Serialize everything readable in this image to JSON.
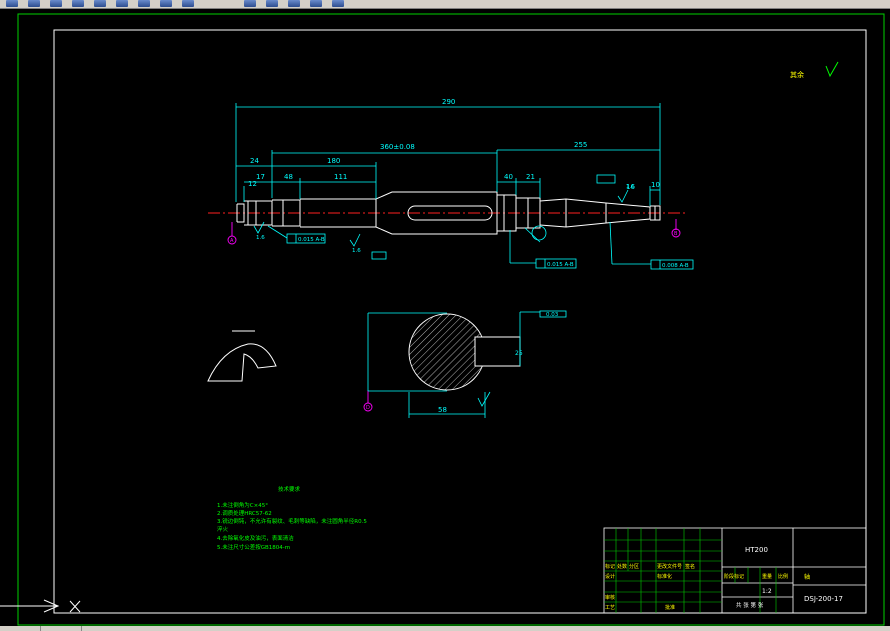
{
  "toolbar": {
    "buttons": [
      "new-icon",
      "open-icon",
      "save-icon",
      "print-icon",
      "cut-icon",
      "copy-icon",
      "paste-icon",
      "undo-icon",
      "redo-icon",
      "pan-icon",
      "zoom-icon",
      "properties-icon",
      "layers-icon",
      "help-icon"
    ]
  },
  "drawing": {
    "dimensions": {
      "overall": "290",
      "left_end": "24",
      "middle_length": "180",
      "span": "360",
      "span_tol": "±0.08",
      "right_length": "255",
      "d_17": "17",
      "d_48": "48",
      "d_111": "111",
      "d_40": "40",
      "d_21": "21",
      "d_10": "10",
      "d_16": "16",
      "d_12": "12",
      "d_58": "58",
      "d_25": "25",
      "roughness_top": "12.5"
    },
    "tolerance_frames": {
      "t1": "0.015  A-B",
      "t2": "0.015  A-B",
      "t3": "0.008  A-B",
      "t4": "0.03"
    },
    "datums": {
      "a": "A",
      "b": "B",
      "c": "D"
    },
    "roughness_labels": [
      "1.6",
      "1.6",
      "1.6",
      "1.6"
    ],
    "notes_title": "技术要求",
    "notes": [
      "1.未注倒角为C×45°",
      "2.调质处理HRC57-62",
      "3.锐边倒钝，不允许有裂纹、毛刺等缺陷，未注圆角半径R0.5",
      "  淬火",
      "4.去除氧化皮及油污，表面清洁",
      "5.未注尺寸公差按GB1804-m"
    ]
  },
  "title_block": {
    "material": "HT200",
    "part_name": "轴",
    "drawing_no": "DSJ-200-17",
    "scale": "1:2",
    "sheet": "共 张  第 张",
    "labels": [
      "标记",
      "处数",
      "分区",
      "更改文件号",
      "签名",
      "年月日",
      "设计",
      "标准化",
      "阶段标记",
      "重量",
      "比例",
      "审核",
      "工艺",
      "批准"
    ]
  },
  "colors": {
    "background": "#000000",
    "frame": "#ffffff",
    "border_green": "#00d000",
    "dimension": "#00ffff",
    "centerline": "#ff2020",
    "note_text": "#00ff00",
    "datum": "#ff00ff",
    "yellow": "#ffff00"
  }
}
